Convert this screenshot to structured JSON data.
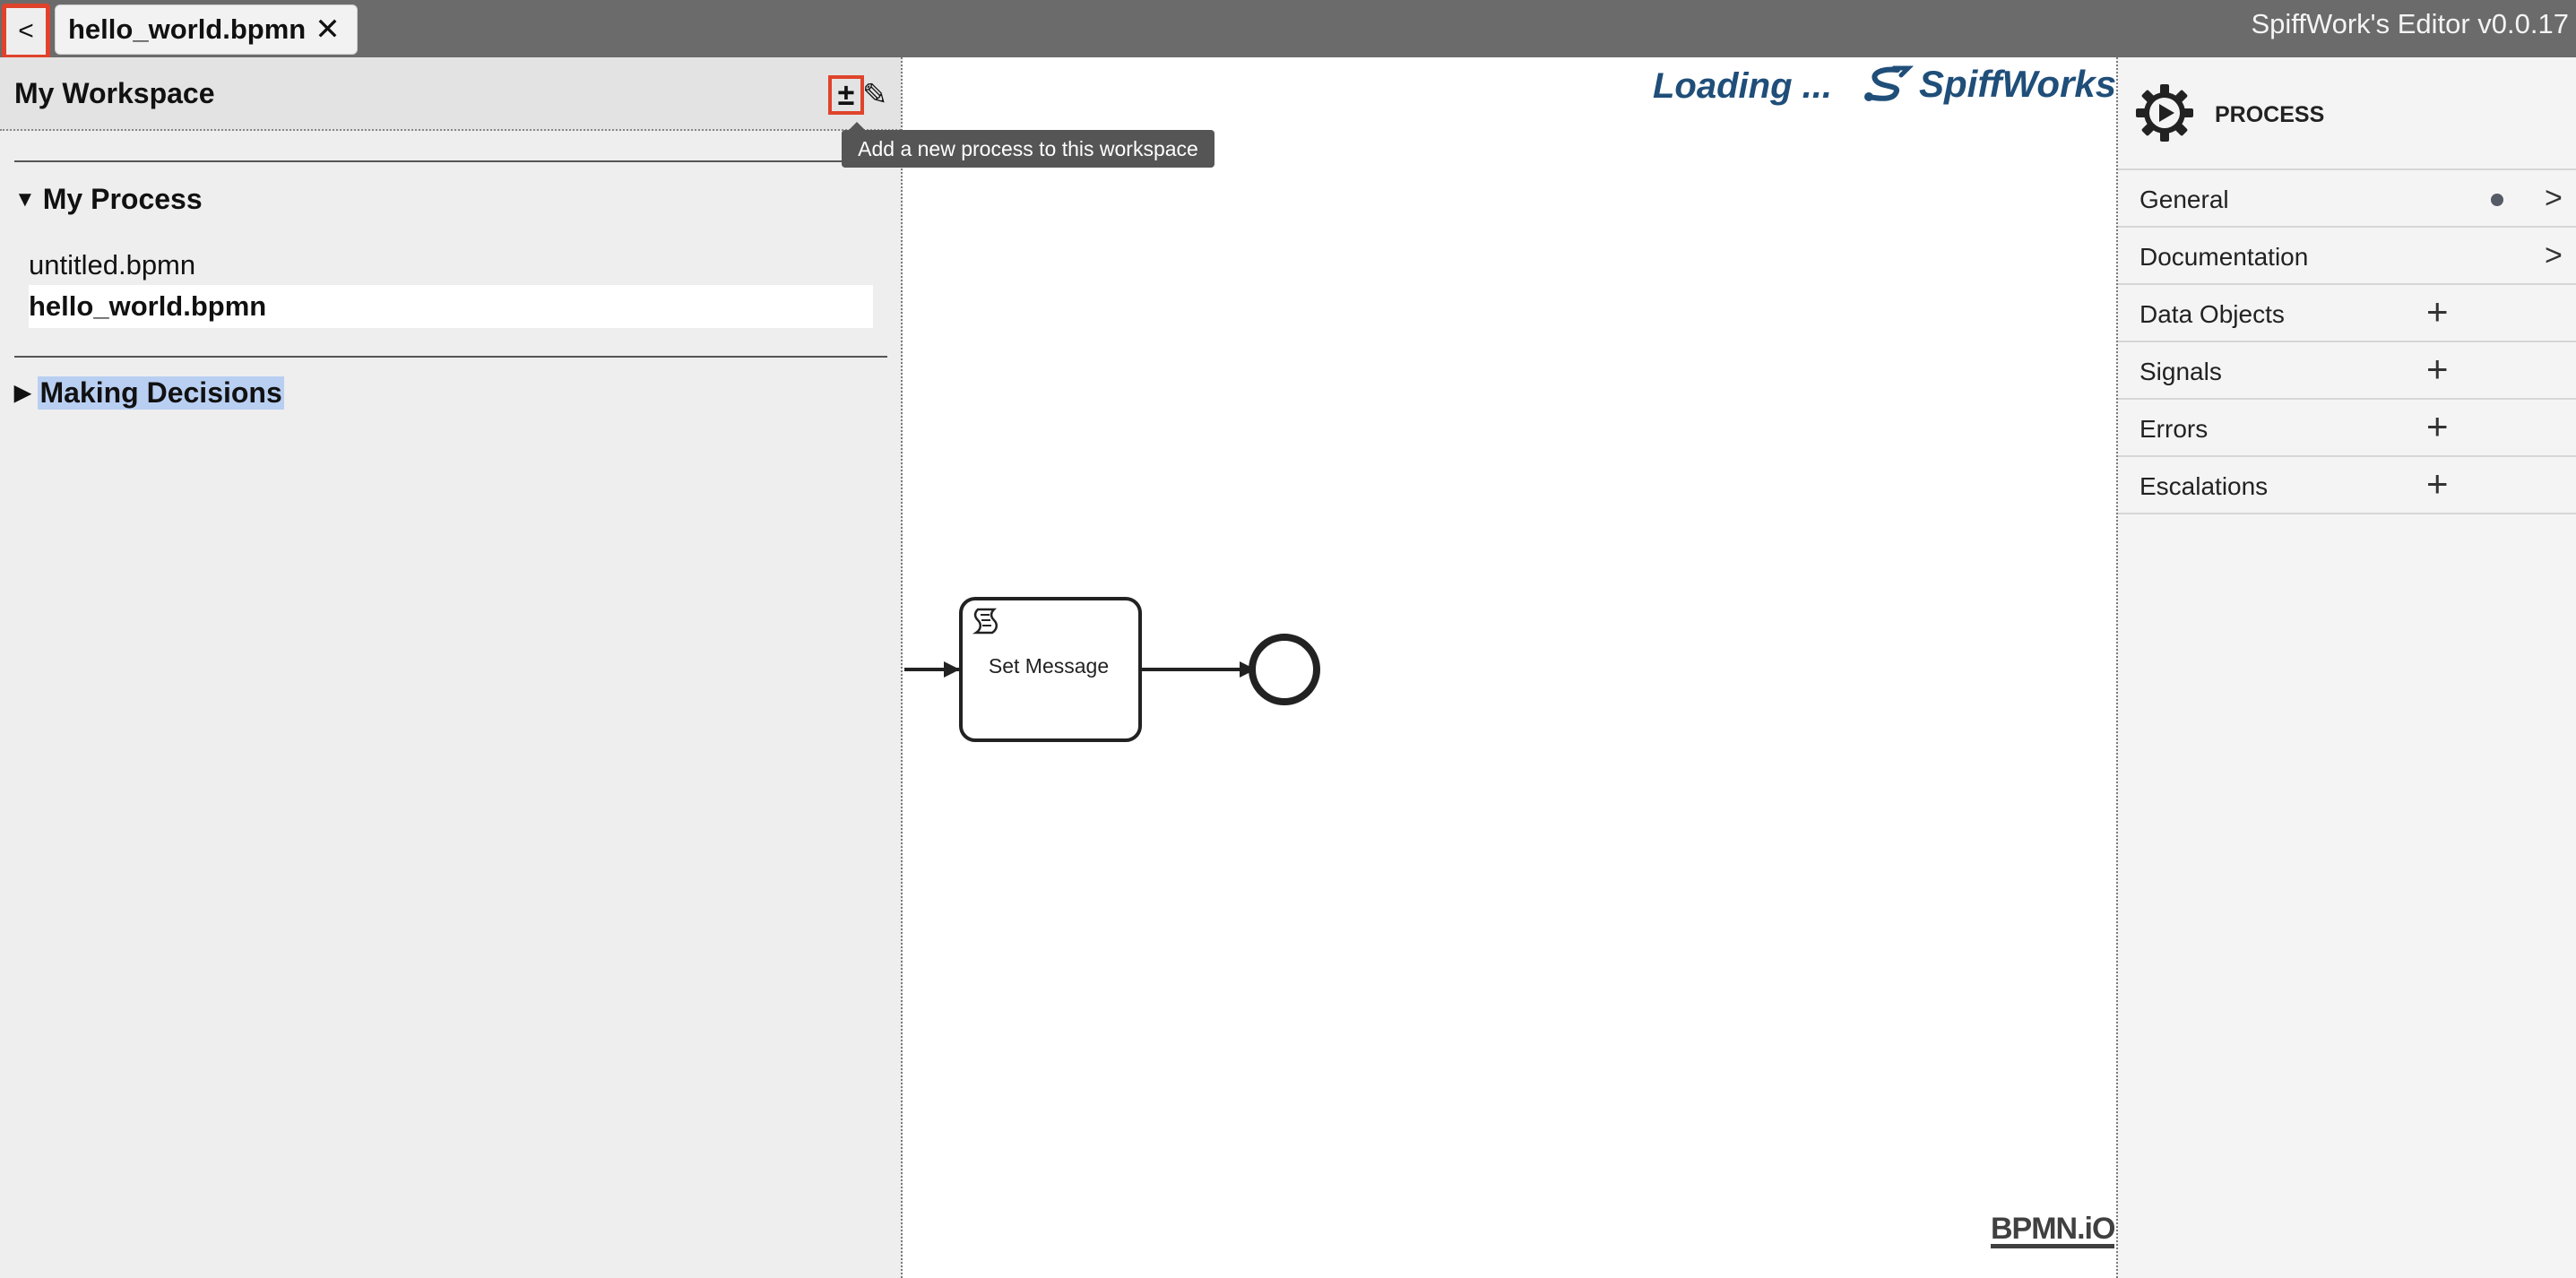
{
  "topbar": {
    "back_label": "<",
    "tab_label": "hello_world.bpmn",
    "tab_close": "✕",
    "app_title": "SpiffWork's Editor v0.0.17"
  },
  "workspace": {
    "title": "My Workspace",
    "add_label": "±",
    "edit_icon": "✎",
    "tooltip": "Add a new process to this workspace",
    "groups": [
      {
        "name": "My Process",
        "expanded": true,
        "files": [
          "untitled.bpmn",
          "hello_world.bpmn"
        ],
        "active_file": "hello_world.bpmn"
      },
      {
        "name": "Making Decisions",
        "expanded": false
      }
    ]
  },
  "canvas": {
    "loading_text": "Loading ...",
    "brand": "SpiffWorks",
    "task_label": "Set Message",
    "watermark": "BPMN.iO"
  },
  "properties": {
    "title": "PROCESS",
    "sections": [
      {
        "label": "General",
        "action": "chevron",
        "dot": true
      },
      {
        "label": "Documentation",
        "action": "chevron",
        "dot": false
      },
      {
        "label": "Data Objects",
        "action": "plus"
      },
      {
        "label": "Signals",
        "action": "plus"
      },
      {
        "label": "Errors",
        "action": "plus"
      },
      {
        "label": "Escalations",
        "action": "plus"
      }
    ],
    "chevron_glyph": ">",
    "plus_glyph": "+"
  },
  "colors": {
    "topbar": "#6b6b6b",
    "highlight": "#e0432b",
    "brand": "#1f4e79",
    "selection": "#b9cff2"
  }
}
